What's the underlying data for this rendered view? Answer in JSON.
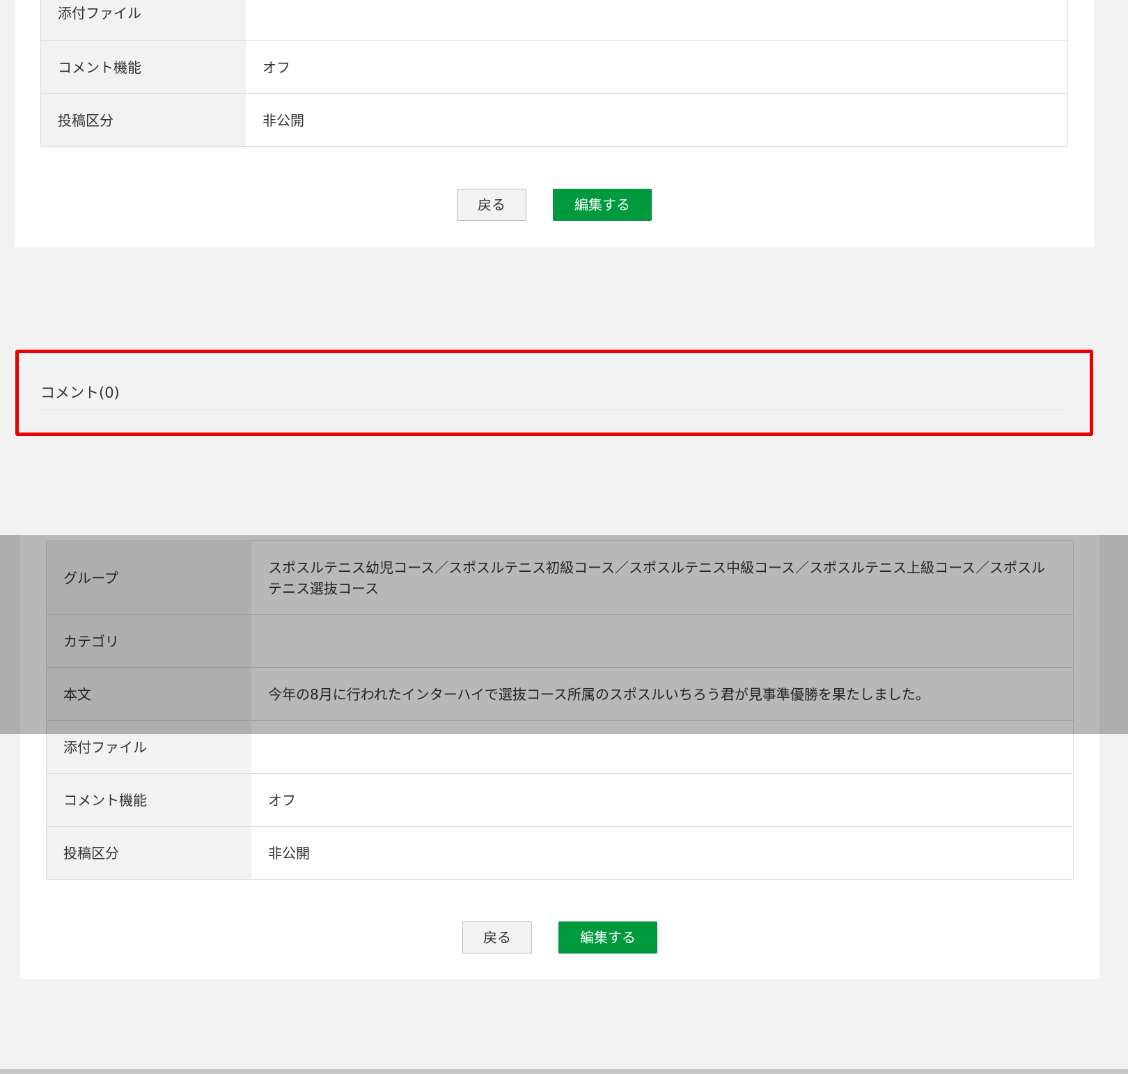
{
  "top_screen": {
    "rows": [
      {
        "label": "添付ファイル",
        "value": ""
      },
      {
        "label": "コメント機能",
        "value": "オフ"
      },
      {
        "label": "投稿区分",
        "value": "非公開"
      }
    ],
    "back_label": "戻る",
    "edit_label": "編集する",
    "comments_heading": "コメント(0)"
  },
  "bottom_screen": {
    "rows": [
      {
        "label": "グループ",
        "value": "スポスルテニス幼児コース／スポスルテニス初級コース／スポスルテニス中級コース／スポスルテニス上級コース／スポスルテニス選抜コース"
      },
      {
        "label": "カテゴリ",
        "value": ""
      },
      {
        "label": "本文",
        "value": "今年の8月に行われたインターハイで選抜コース所属のスポスルいちろう君が見事準優勝を果たしました。"
      },
      {
        "label": "添付ファイル",
        "value": ""
      },
      {
        "label": "コメント機能",
        "value": "オフ"
      },
      {
        "label": "投稿区分",
        "value": "非公開"
      }
    ],
    "back_label": "戻る",
    "edit_label": "編集する"
  },
  "colors": {
    "accent_green": "#009a3e",
    "highlight_red": "#ee0000",
    "label_bg": "#f2f2f2"
  }
}
